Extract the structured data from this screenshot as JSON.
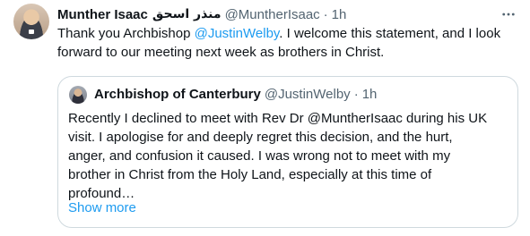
{
  "tweet": {
    "author_name": "Munther Isaac",
    "author_name_arabic": "منذر اسحق",
    "author_handle": "@MuntherIsaac",
    "separator": "·",
    "time": "1h",
    "text_before_mention": "Thank you Archbishop ",
    "mention": "@JustinWelby",
    "text_after_mention": ". I welcome this statement, and I look forward to our meeting next week as brothers in Christ.",
    "more_icon": "more-horizontal-icon"
  },
  "quote": {
    "author_name": "Archbishop of Canterbury",
    "author_handle": "@JustinWelby",
    "separator": "·",
    "time": "1h",
    "lines": [
      "Recently I declined to meet with Rev Dr @MuntherIsaac during his UK",
      "visit. I apologise for and deeply regret this decision, and the hurt,",
      "anger, and confusion it caused. I was wrong not to meet with my",
      "brother in Christ from the Holy Land, especially at this time of",
      "profound…"
    ],
    "show_more_label": "Show more"
  },
  "colors": {
    "link": "#1d9bf0",
    "secondary_text": "#536471",
    "border": "#cfd9de",
    "primary_text": "#0f1419"
  }
}
